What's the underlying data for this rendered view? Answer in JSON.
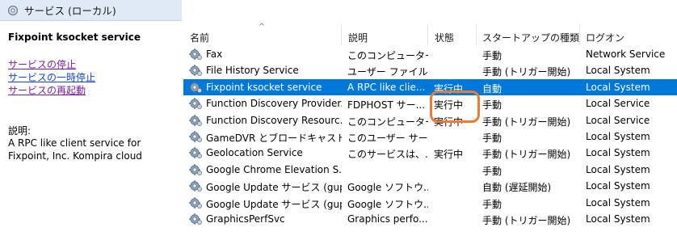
{
  "window": {
    "title": "サービス (ローカル)"
  },
  "left_pane": {
    "service_title": "Fixpoint ksocket service",
    "links": [
      "サービスの停止",
      "サービスの一時停止",
      "サービスの再起動"
    ],
    "description_label": "説明:",
    "description": "A RPC like client service for Fixpoint, Inc. Kompira cloud"
  },
  "table": {
    "headers": [
      "名前",
      "説明",
      "状態",
      "スタートアップの種類",
      "ログオン"
    ],
    "rows": [
      {
        "name": "Fax",
        "desc": "このコンピューター...",
        "state": "",
        "startup": "手動",
        "logon": "Network Service"
      },
      {
        "name": "File History Service",
        "desc": "ユーザー ファイル...",
        "state": "",
        "startup": "手動 (トリガー開始)",
        "logon": "Local System"
      },
      {
        "name": "Fixpoint ksocket service",
        "desc": "A RPC like clie...",
        "state": "実行中",
        "startup": "自動",
        "logon": "Local System"
      },
      {
        "name": "Function Discovery Provider...",
        "desc": "FDPHOST サー...",
        "state": "実行中",
        "startup": "手動",
        "logon": "Local Service"
      },
      {
        "name": "Function Discovery Resourc...",
        "desc": "このコンピューター...",
        "state": "実行中",
        "startup": "手動 (トリガー開始)",
        "logon": "Local Service"
      },
      {
        "name": "GameDVR とブロードキャスト ユ...",
        "desc": "このユーザー サー...",
        "state": "",
        "startup": "手動",
        "logon": "Local System"
      },
      {
        "name": "Geolocation Service",
        "desc": "このサービスは、...",
        "state": "実行中",
        "startup": "手動 (トリガー開始)",
        "logon": "Local System"
      },
      {
        "name": "Google Chrome Elevation S...",
        "desc": "",
        "state": "",
        "startup": "手動",
        "logon": "Local System"
      },
      {
        "name": "Google Update サービス (gup...",
        "desc": "Google ソフトウ...",
        "state": "",
        "startup": "自動 (遅延開始)",
        "logon": "Local System"
      },
      {
        "name": "Google Update サービス (gup...",
        "desc": "Google ソフトウ...",
        "state": "",
        "startup": "手動",
        "logon": "Local System"
      },
      {
        "name": "GraphicsPerfSvc",
        "desc": "Graphics perfo...",
        "state": "",
        "startup": "手動 (トリガー開始)",
        "logon": "Local System"
      }
    ],
    "selected_index": 2
  },
  "colors": {
    "selection": "#0078d7",
    "highlight": "#ee7b30",
    "link": "#7a1fa2"
  },
  "icons": {
    "title": "services-icon",
    "row": "gear-icon"
  }
}
